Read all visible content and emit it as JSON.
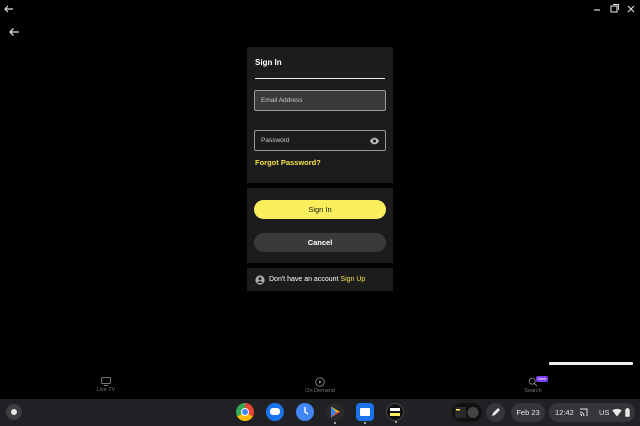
{
  "window": {
    "back_icon": "arrow-left-icon",
    "min_icon": "minimize-icon",
    "max_icon": "maximize-icon",
    "close_icon": "close-icon"
  },
  "signin": {
    "title": "Sign In",
    "email_placeholder": "Email Address",
    "password_placeholder": "Password",
    "forgot_password": "Forgot Password?",
    "signin_button": "Sign In",
    "cancel_button": "Cancel",
    "no_account_text": "Don't have an account",
    "signup_link": "Sign Up"
  },
  "nav": {
    "items": [
      {
        "label": "Live TV",
        "icon": "tv-icon"
      },
      {
        "label": "On Demand",
        "icon": "play-circle-icon"
      },
      {
        "label": "Search",
        "icon": "search-icon",
        "badge": "New"
      }
    ]
  },
  "shelf": {
    "apps": [
      "chrome",
      "messages",
      "clock",
      "play-store",
      "files",
      "pluto-tv"
    ],
    "date": "Feb 23",
    "time": "12:42",
    "locale": "US"
  },
  "colors": {
    "accent": "#f9ee5c",
    "panel": "#1c1c1c",
    "badge": "#7b3cf0"
  }
}
